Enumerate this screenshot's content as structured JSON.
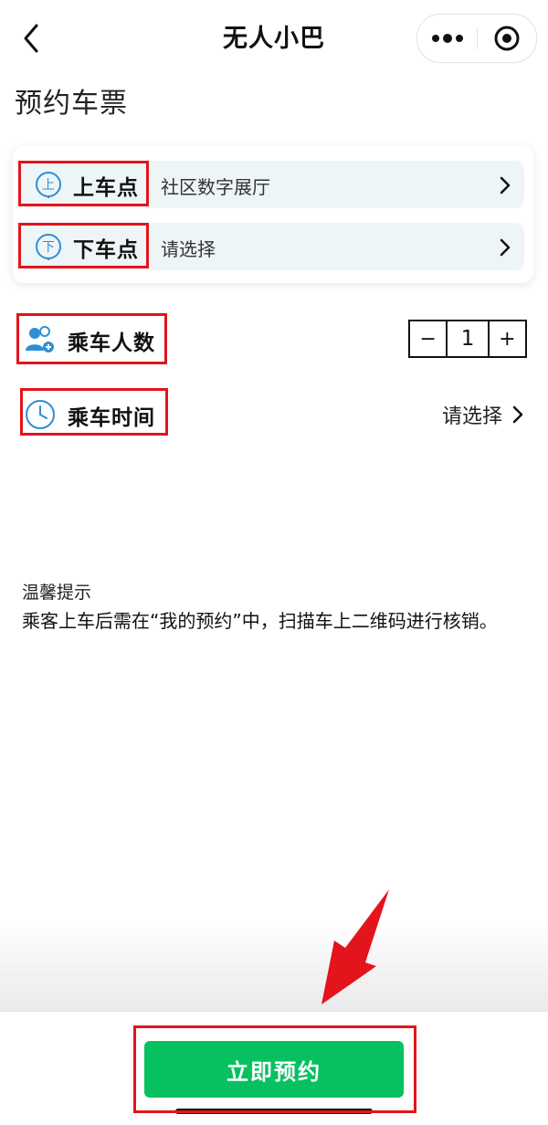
{
  "navbar": {
    "title": "无人小巴",
    "back_icon": "chevron-left-icon",
    "more_icon": "more-dots-icon",
    "close_icon": "target-circle-icon"
  },
  "page": {
    "heading": "预约车票"
  },
  "stops": {
    "pickup": {
      "icon_char": "上",
      "label": "上车点",
      "value": "社区数字展厅"
    },
    "dropoff": {
      "icon_char": "下",
      "label": "下车点",
      "value": "请选择"
    }
  },
  "passengers": {
    "label": "乘车人数",
    "icon": "people-icon",
    "count": "1",
    "minus": "−",
    "plus": "+"
  },
  "ride_time": {
    "label": "乘车时间",
    "icon": "clock-icon",
    "value": "请选择"
  },
  "tips": {
    "title": "温馨提示",
    "body": "乘客上车后需在“我的预约”中，扫描车上二维码进行核销。"
  },
  "submit": {
    "label": "立即预约"
  },
  "colors": {
    "accent_blue": "#2d8fd5",
    "button_green": "#07c160",
    "highlight_red": "#e3141c",
    "row_bg": "#eef5f7"
  }
}
